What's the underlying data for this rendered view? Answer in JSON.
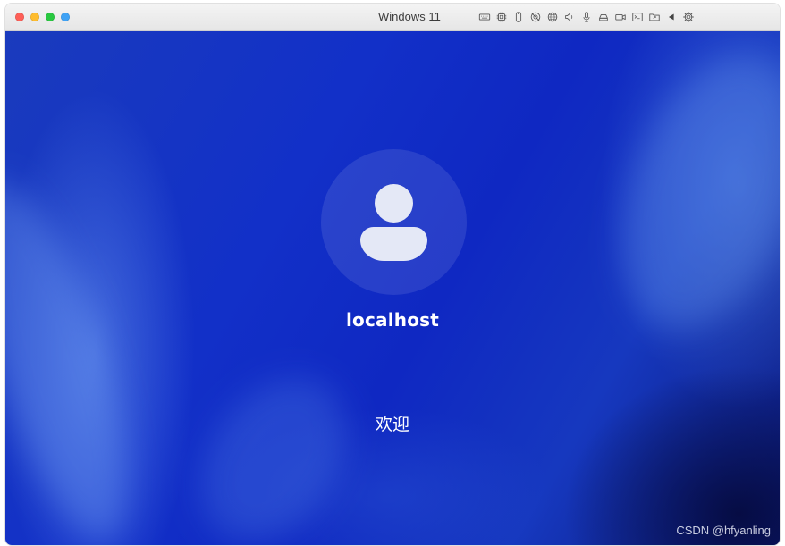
{
  "window": {
    "title": "Windows 11",
    "traffic_lights": [
      {
        "name": "close",
        "color": "#fe5f57"
      },
      {
        "name": "minimize",
        "color": "#febc2e"
      },
      {
        "name": "zoom",
        "color": "#28c840"
      },
      {
        "name": "extra",
        "color": "#3fa2f5"
      }
    ],
    "toolbar_icons": [
      "keyboard-icon",
      "cpu-icon",
      "usb-drive-icon",
      "no-camera-icon",
      "network-globe-icon",
      "speaker-icon",
      "microphone-icon",
      "drive-eject-icon",
      "camera-icon",
      "terminal-icon",
      "shared-folder-icon",
      "arrow-left-icon",
      "gear-icon"
    ]
  },
  "login": {
    "username": "localhost",
    "welcome": "欢迎"
  },
  "watermark": "CSDN @hfyanling",
  "colors": {
    "wallpaper_base": "#1230c8",
    "avatar_fill": "#e4e8f6",
    "text": "#ffffff"
  }
}
